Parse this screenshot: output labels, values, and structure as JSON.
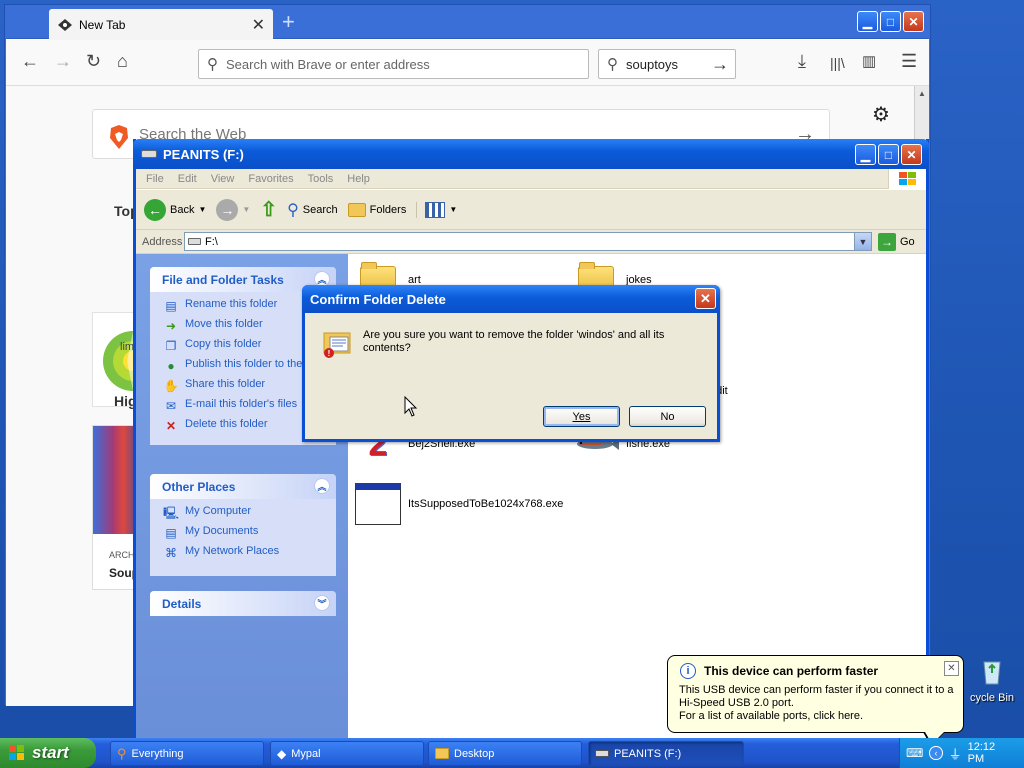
{
  "browser": {
    "tab_title": "New Tab",
    "url_placeholder": "Search with Brave or enter address",
    "search_value": "souptoys",
    "web_search_placeholder": "Search the Web",
    "top_sites_heading": "Top",
    "top_site_label": "lim",
    "highlights_heading": "High",
    "highlight_meta": "ARCH",
    "highlight_title": "Soup"
  },
  "explorer": {
    "title": "PEANITS (F:)",
    "menu": [
      "File",
      "Edit",
      "View",
      "Favorites",
      "Tools",
      "Help"
    ],
    "toolbar": {
      "back": "Back",
      "search": "Search",
      "folders": "Folders"
    },
    "address_label": "Address",
    "address_value": "F:\\",
    "go_label": "Go",
    "file_tasks": {
      "title": "File and Folder Tasks",
      "items": [
        "Rename this folder",
        "Move this folder",
        "Copy this folder",
        "Publish this folder to the Web",
        "Share this folder",
        "E-mail this folder's files",
        "Delete this folder"
      ]
    },
    "other_places": {
      "title": "Other Places",
      "items": [
        "My Computer",
        "My Documents",
        "My Network Places"
      ]
    },
    "details": {
      "title": "Details"
    },
    "files": [
      {
        "name": "art",
        "kind": "folder"
      },
      {
        "name": "jokes",
        "kind": "folder"
      },
      {
        "name": "edit",
        "kind": "file"
      },
      {
        "name": "Bej2Shell.exe",
        "kind": "exe"
      },
      {
        "name": "fishe.exe",
        "kind": "exe"
      },
      {
        "name": "ItsSupposedToBe1024x768.exe",
        "kind": "exe"
      }
    ]
  },
  "dialog": {
    "title": "Confirm Folder Delete",
    "message": "Are you sure you want to remove the folder 'windos' and all its contents?",
    "yes": "Yes",
    "no": "No"
  },
  "balloon": {
    "title": "This device can perform faster",
    "line1": "This USB device can perform faster if you connect it to a Hi-Speed USB 2.0 port.",
    "line2": "For a list of available ports, click here."
  },
  "desktop": {
    "recycle_label": "cycle Bin"
  },
  "taskbar": {
    "start": "start",
    "tasks": [
      "Everything",
      "Mypal",
      "Desktop",
      "PEANITS (F:)"
    ],
    "clock": "12:12 PM"
  },
  "colors": {
    "xp_blue": "#0a4fd3",
    "link_blue": "#215dc6",
    "start_green": "#3b9b3a"
  }
}
